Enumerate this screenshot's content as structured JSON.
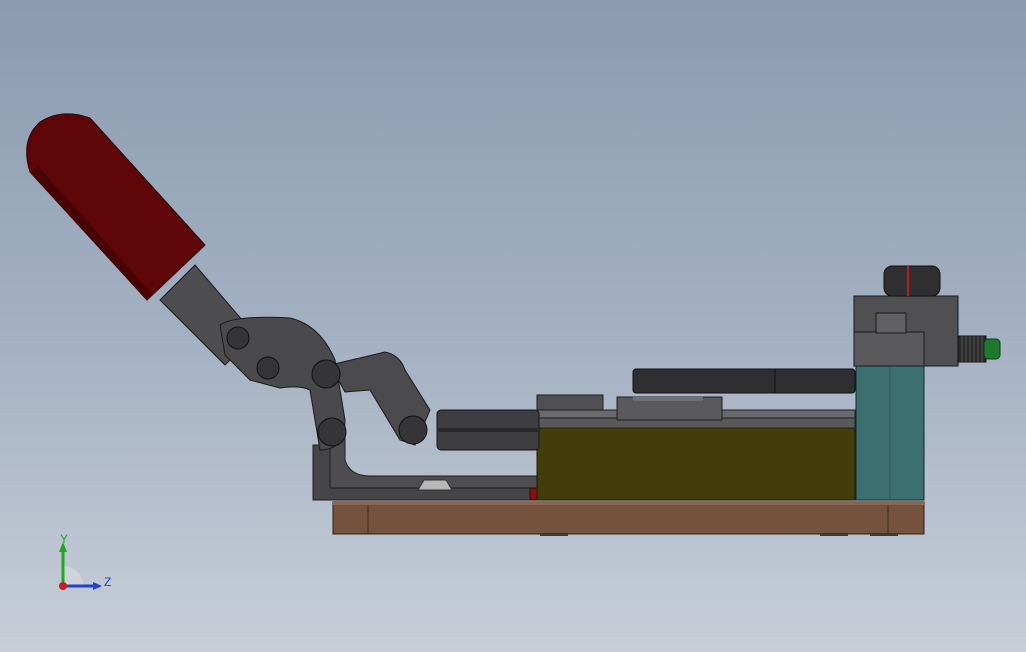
{
  "viewport": {
    "background_top": "#8b9bb0",
    "background_bottom": "#c7ced8"
  },
  "model": {
    "parts": [
      {
        "name": "handle-grip",
        "color": "#5e0608"
      },
      {
        "name": "clamp-linkage",
        "color": "#4b4b4d"
      },
      {
        "name": "clamp-base",
        "color": "#464648"
      },
      {
        "name": "slide-block",
        "color": "#423d0b"
      },
      {
        "name": "top-plate",
        "color": "#2f2f31"
      },
      {
        "name": "end-block",
        "color": "#3b6f70"
      },
      {
        "name": "base-plate",
        "color": "#75523d"
      },
      {
        "name": "knurled-knob",
        "color": "#2a2a2a"
      },
      {
        "name": "green-cap",
        "color": "#1f7a2c"
      },
      {
        "name": "red-pins",
        "color": "#8a1010"
      }
    ]
  },
  "triad": {
    "y_label": "Y",
    "z_label": "Z",
    "y_color": "#1fa81f",
    "z_color": "#1f3fd6",
    "x_color": "#c41e1e"
  }
}
